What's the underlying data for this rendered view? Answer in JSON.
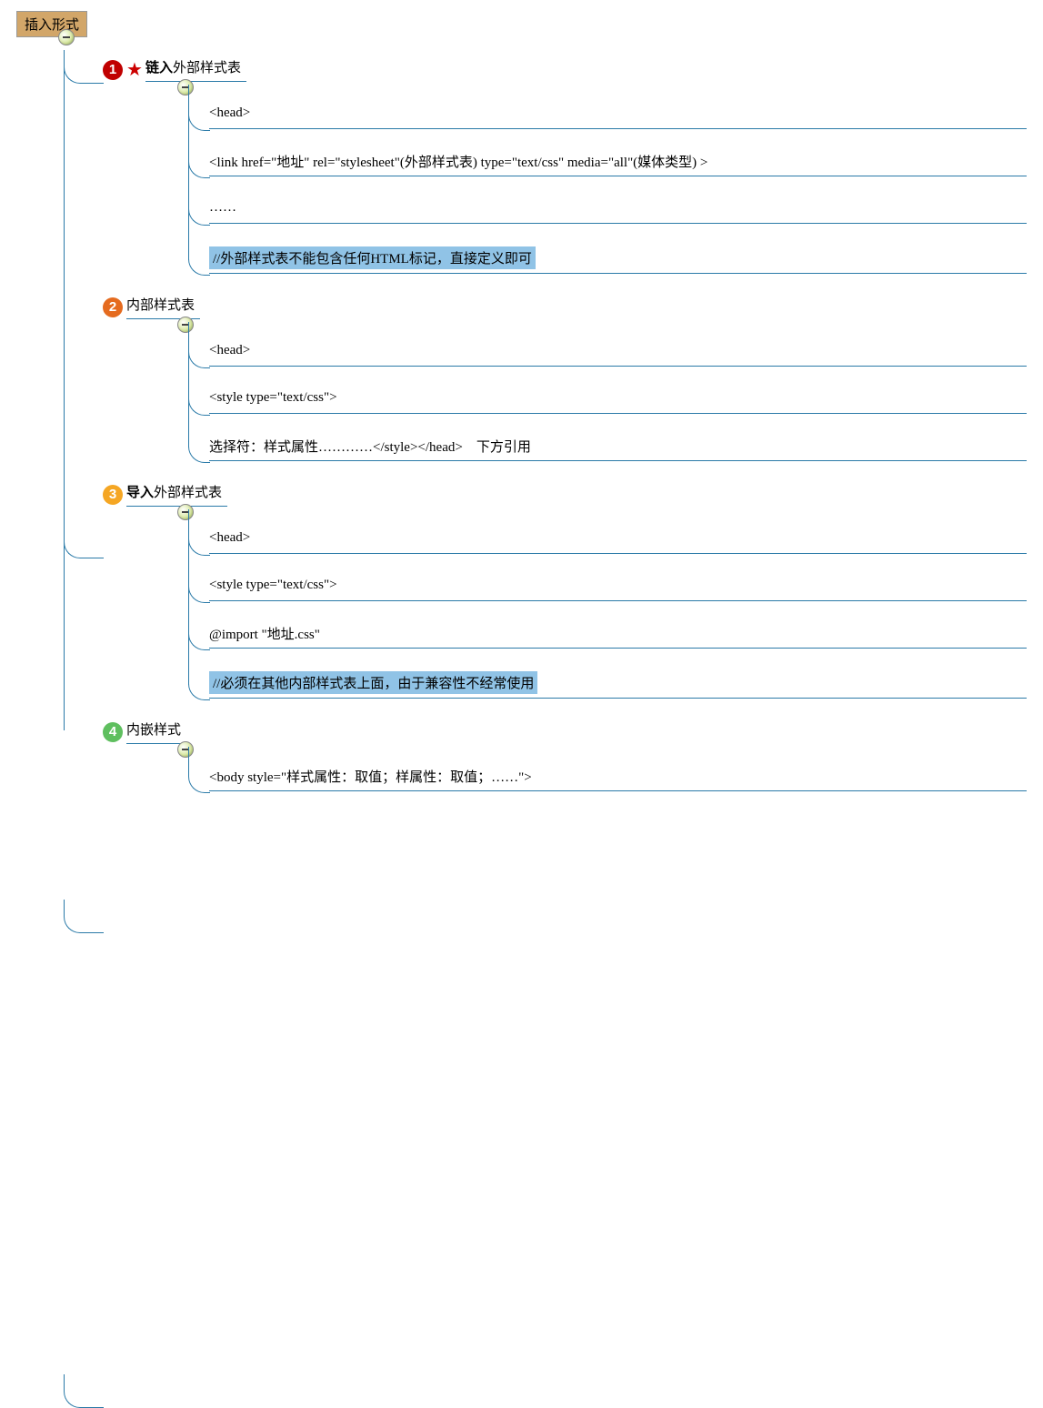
{
  "root": {
    "label": "插入形式"
  },
  "nodes": [
    {
      "num": "1",
      "color": "#c00000",
      "starred": true,
      "title_bold": "链入",
      "title_rest": "外部样式表",
      "children": [
        {
          "text": "<head>",
          "hi": false
        },
        {
          "text": "<link href=\"地址\" rel=\"stylesheet\"(外部样式表) type=\"text/css\" media=\"all\"(媒体类型) >",
          "hi": false
        },
        {
          "text": "……",
          "hi": false
        },
        {
          "text": "//外部样式表不能包含任何HTML标记，直接定义即可",
          "hi": true
        }
      ]
    },
    {
      "num": "2",
      "color": "#e56b1f",
      "starred": false,
      "title_bold": "",
      "title_rest": "内部样式表",
      "children": [
        {
          "text": "<head>",
          "hi": false
        },
        {
          "text": "<style type=\"text/css\">",
          "hi": false
        },
        {
          "text": "选择符：样式属性…………</style></head>　下方引用",
          "hi": false
        }
      ]
    },
    {
      "num": "3",
      "color": "#f5a623",
      "starred": false,
      "title_bold": "导入",
      "title_rest": "外部样式表",
      "children": [
        {
          "text": "<head>",
          "hi": false
        },
        {
          "text": "<style type=\"text/css\">",
          "hi": false
        },
        {
          "text": "@import \"地址.css\"",
          "hi": false
        },
        {
          "text": "//必须在其他内部样式表上面，由于兼容性不经常使用",
          "hi": true
        }
      ]
    },
    {
      "num": "4",
      "color": "#5fbf5f",
      "starred": false,
      "title_bold": "",
      "title_rest": "内嵌样式",
      "children": [
        {
          "text": "<body style=\"样式属性：取值；样属性：取值；……\">",
          "hi": false
        }
      ]
    }
  ]
}
